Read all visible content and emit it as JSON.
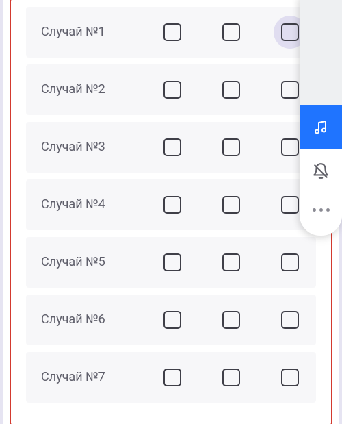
{
  "rows": [
    {
      "label": "Случай №1"
    },
    {
      "label": "Случай №2"
    },
    {
      "label": "Случай №3"
    },
    {
      "label": "Случай №4"
    },
    {
      "label": "Случай №5"
    },
    {
      "label": "Случай №6"
    },
    {
      "label": "Случай №7"
    }
  ],
  "highlighted_checkbox": {
    "row": 0,
    "col": 2
  },
  "panel": {
    "active": "music",
    "colors": {
      "active_bg": "#1f74ff",
      "active_fg": "#ffffff",
      "inactive_fg": "#606068"
    }
  }
}
